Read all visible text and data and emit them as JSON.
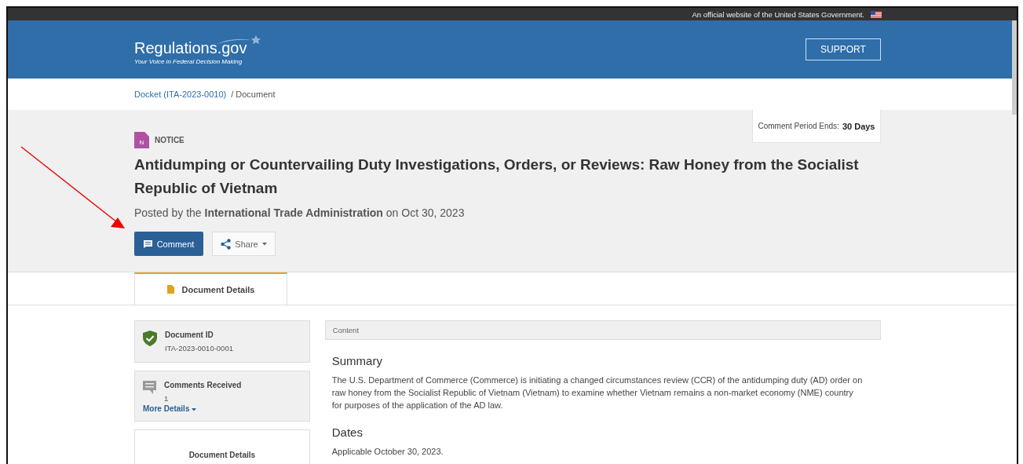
{
  "top_bar": {
    "text": "An official website of the United States Government."
  },
  "header": {
    "logo": "Regulations.gov",
    "tagline": "Your Voice in Federal Decision Making",
    "support_button": "SUPPORT"
  },
  "breadcrumb": [
    {
      "label": "Docket (ITA-2023-0010)",
      "kind": "link"
    },
    {
      "label": "/ Document",
      "kind": "current"
    }
  ],
  "comment_period": {
    "label": "Comment Period Ends:",
    "value": "30 Days"
  },
  "document": {
    "type_letter": "N",
    "type": "NOTICE",
    "title": "Antidumping or Countervailing Duty Investigations, Orders, or Reviews: Raw Honey from the Socialist Republic of Vietnam",
    "posted": "Posted by the **International Trade Administration** on Oct 30, 2023"
  },
  "actions": {
    "comment_button": "Comment",
    "share_button": "Share"
  },
  "tabs": [
    {
      "label": "Document Details",
      "selected": true
    }
  ],
  "sidebar": [
    {
      "kind": "id",
      "title": "Document ID",
      "value": "ITA-2023-0010-0001"
    },
    {
      "kind": "comments",
      "title": "Comments Received",
      "value": "1",
      "link": "More Details"
    },
    {
      "kind": "plain",
      "title": "Document Details"
    }
  ],
  "content": {
    "header": "Content",
    "sections": [
      {
        "heading": "Summary",
        "text": "The U.S. Department of Commerce (Commerce) is initiating a changed circumstances review (CCR) of the antidumping duty (AD) order on raw honey from the Socialist Republic of Vietnam (Vietnam) to examine whether Vietnam remains a non-market economy (NME) country for purposes of the application of the AD law."
      },
      {
        "heading": "Dates",
        "text": "Applicable October 30, 2023."
      }
    ]
  }
}
